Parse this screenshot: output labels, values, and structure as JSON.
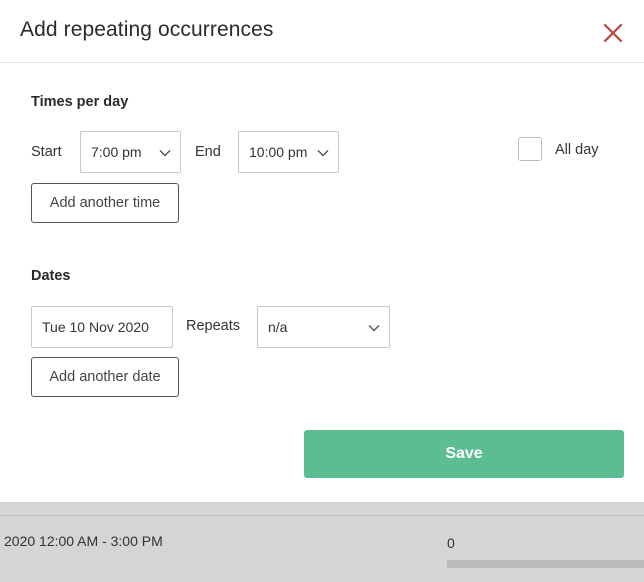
{
  "dialog": {
    "title": "Add repeating occurrences",
    "close_icon": "close-icon",
    "accent_color": "#5cbc92",
    "close_color": "#b5473f"
  },
  "times": {
    "section_label": "Times per day",
    "start_label": "Start",
    "start_value": "7:00 pm",
    "end_label": "End",
    "end_value": "10:00 pm",
    "all_day_label": "All day",
    "all_day_checked": false,
    "add_button": "Add another time"
  },
  "dates": {
    "section_label": "Dates",
    "date_value": "Tue 10 Nov 2020",
    "repeats_label": "Repeats",
    "repeats_value": "n/a",
    "add_button": "Add another date"
  },
  "actions": {
    "save_label": "Save"
  },
  "background": {
    "row_text": "2020 12:00 AM - 3:00 PM",
    "row_count": "0"
  }
}
